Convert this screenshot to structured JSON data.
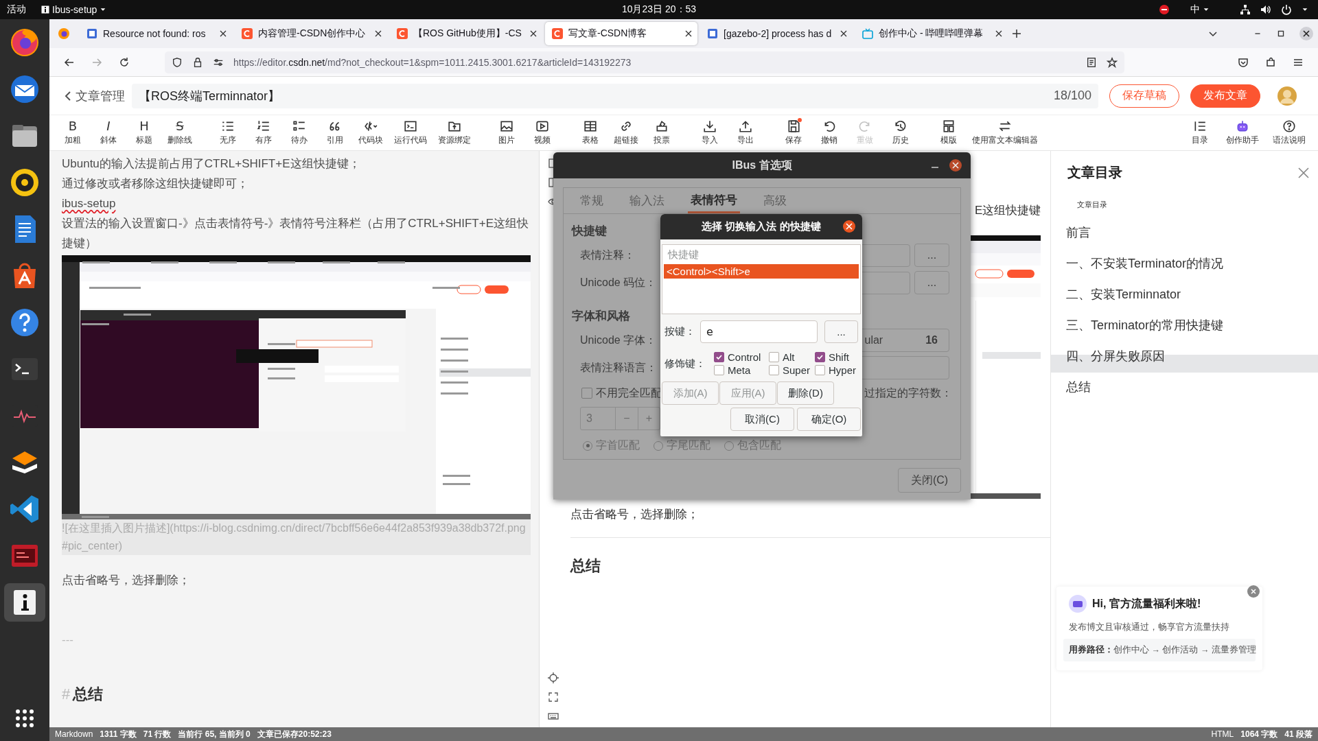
{
  "top_bar": {
    "activities": "活动",
    "app_menu": "Ibus-setup",
    "clock": "10月23日  20：53",
    "input_method": "中"
  },
  "dock": {
    "apps": [
      {
        "kind": "firefox",
        "selected": false
      },
      {
        "kind": "mail",
        "selected": false
      },
      {
        "kind": "files",
        "selected": false
      },
      {
        "kind": "music",
        "selected": false
      },
      {
        "kind": "writer",
        "selected": false
      },
      {
        "kind": "store",
        "selected": false
      },
      {
        "kind": "help",
        "selected": false
      },
      {
        "kind": "terminal",
        "selected": false
      },
      {
        "kind": "monitor",
        "selected": false
      },
      {
        "kind": "stack",
        "selected": false
      },
      {
        "kind": "vscode",
        "selected": false
      },
      {
        "kind": "redapp",
        "selected": false
      },
      {
        "kind": "info",
        "selected": true
      }
    ]
  },
  "browser": {
    "tabs": [
      {
        "title": "Resource not found: ros",
        "kind": "page",
        "selected": false
      },
      {
        "title": "内容管理-CSDN创作中心",
        "kind": "csdn",
        "selected": false
      },
      {
        "title": "【ROS GitHub使用】-CS",
        "kind": "csdn",
        "selected": false
      },
      {
        "title": "写文章-CSDN博客",
        "kind": "csdn",
        "selected": true
      },
      {
        "title": "[gazebo-2] process has d",
        "kind": "page",
        "selected": false
      },
      {
        "title": "创作中心 - 哔哩哔哩弹幕",
        "kind": "tv",
        "selected": false
      }
    ],
    "url": "https://editor.**csdn.net**/md?not_checkout=1&spm=1011.2415.3001.6217&articleId=143192273"
  },
  "csdn_header": {
    "back_label": "文章管理",
    "title": "【ROS终端Terminnator】",
    "count": "18/100",
    "save_draft": "保存草稿",
    "publish": "发布文章"
  },
  "toolbar": {
    "groups": [
      [
        {
          "label": "加粗",
          "glyph": "B",
          "disabled": false,
          "dot": false
        },
        {
          "label": "斜体",
          "glyph": "I",
          "disabled": false,
          "dot": false
        },
        {
          "label": "标题",
          "glyph": "H",
          "disabled": false,
          "dot": false
        },
        {
          "label": "删除线",
          "glyph": "S",
          "disabled": false,
          "dot": false
        }
      ],
      [
        {
          "label": "无序",
          "disabled": false,
          "dot": false
        },
        {
          "label": "有序",
          "disabled": false,
          "dot": false
        },
        {
          "label": "待办",
          "disabled": false,
          "dot": false
        },
        {
          "label": "引用",
          "disabled": false,
          "dot": false
        },
        {
          "label": "代码块",
          "disabled": false,
          "dot": false
        },
        {
          "label": "运行代码",
          "disabled": false,
          "dot": false
        },
        {
          "label": "资源绑定",
          "disabled": false,
          "dot": false
        }
      ],
      [
        {
          "label": "图片",
          "disabled": false,
          "dot": false
        },
        {
          "label": "视频",
          "disabled": false,
          "dot": false
        }
      ],
      [
        {
          "label": "表格",
          "disabled": false,
          "dot": false
        },
        {
          "label": "超链接",
          "disabled": false,
          "dot": false
        },
        {
          "label": "投票",
          "disabled": false,
          "dot": false
        }
      ],
      [
        {
          "label": "导入",
          "disabled": false,
          "dot": false
        },
        {
          "label": "导出",
          "disabled": false,
          "dot": false
        }
      ],
      [
        {
          "label": "保存",
          "disabled": false,
          "dot": true
        },
        {
          "label": "撤销",
          "disabled": false,
          "dot": false
        },
        {
          "label": "重做",
          "disabled": true,
          "dot": false
        },
        {
          "label": "历史",
          "disabled": false,
          "dot": false
        }
      ],
      [
        {
          "label": "模版",
          "disabled": false,
          "dot": false
        },
        {
          "label": "使用富文本编辑器",
          "disabled": false,
          "dot": false
        }
      ]
    ],
    "right": [
      {
        "label": "目录",
        "disabled": false,
        "dot": false
      },
      {
        "label": "创作助手",
        "disabled": false,
        "dot": false
      },
      {
        "label": "语法说明",
        "disabled": false,
        "dot": false
      }
    ]
  },
  "editor": {
    "blocks": [
      {
        "kind": "text",
        "text": "Ubuntu的输入法提前占用了CTRL+SHIFT+E这组快捷键；"
      },
      {
        "kind": "text",
        "text": "通过修改或者移除这组快捷键即可；"
      },
      {
        "kind": "misspelled",
        "text": "ibus-setup"
      },
      {
        "kind": "text",
        "text": "设置法的输入设置窗口-》点击表情符号-》表情符号注释栏（占用了CTRL+SHIFT+E这组快捷键）"
      },
      {
        "kind": "image"
      },
      {
        "kind": "image_link",
        "text": "![在这里插入图片描述](https://i-blog.csdnimg.cn/direct/7bcbff56e6e44f2a853f939a38db372f.png#pic_center)"
      },
      {
        "kind": "text",
        "text": "点击省略号，选择删除；"
      },
      {
        "kind": "rule",
        "text": "---"
      },
      {
        "kind": "heading",
        "mark": "#",
        "text": "总结"
      }
    ]
  },
  "preview": {
    "fragment": "E这组快捷键",
    "paragraph": "点击省略号，选择删除；",
    "heading": "总结"
  },
  "toc": {
    "title": "文章目录",
    "subtitle": "文章目录",
    "items": [
      {
        "text": "前言",
        "selected": false
      },
      {
        "text": "一、不安装Terminator的情况",
        "selected": false
      },
      {
        "text": "二、安装Terminnator",
        "selected": false
      },
      {
        "text": "三、Terminator的常用快捷键",
        "selected": false
      },
      {
        "text": "四、分屏失败原因",
        "selected": true
      },
      {
        "text": "总结",
        "selected": false
      }
    ]
  },
  "promo": {
    "title": "Hi, 官方流量福利来啦!",
    "text": "发布博文且审核通过，畅享官方流量扶持",
    "path": "**用券路径：**创作中心 → 创作活动 → 流量券管理"
  },
  "status_bar": {
    "left_mode": "Markdown",
    "left_stats": [
      "1311 字数",
      "71 行数",
      "当前行 65, 当前列 0",
      "文章已保存20:52:23"
    ],
    "right_mode": "HTML",
    "right_stats": [
      "1064 字数",
      "41 段落"
    ]
  },
  "ibus_window": {
    "title": "IBus 首选项",
    "tabs": [
      {
        "label": "常规",
        "selected": false
      },
      {
        "label": "输入法",
        "selected": false
      },
      {
        "label": "表情符号",
        "selected": true
      },
      {
        "label": "高级",
        "selected": false
      }
    ],
    "shortcuts_heading": "快捷键",
    "emoji_label": "表情注释：",
    "unicode_label": "Unicode 码位：",
    "more_buttons": [
      "...",
      "..."
    ],
    "font_heading": "字体和风格",
    "font_label": "Unicode 字体：",
    "font_value": "ular",
    "font_size": "16",
    "lang_label": "表情注释语言：",
    "partial_check": {
      "text": "不用完全匹配",
      "checked": false
    },
    "partial_tail": "过指定的字符数：",
    "spin_value": "3",
    "spin_buttons": [
      "−",
      "+"
    ],
    "radios": [
      {
        "label": "字首匹配",
        "selected": true
      },
      {
        "label": "字尾匹配",
        "selected": false
      },
      {
        "label": "包含匹配",
        "selected": false
      }
    ],
    "close_button": "关闭(C)"
  },
  "key_dialog": {
    "title": "选择 切换输入法 的快捷键",
    "list_header": "快捷键",
    "shortcuts": [
      {
        "text": "<Control><Shift>e",
        "selected": true
      }
    ],
    "key_label": "按键：",
    "key_value": "e",
    "more_button": "...",
    "modifier_label": "修饰键：",
    "modifiers": [
      {
        "label": "Control",
        "checked": true
      },
      {
        "label": "Alt",
        "checked": false
      },
      {
        "label": "Shift",
        "checked": true
      },
      {
        "label": "Meta",
        "checked": false
      },
      {
        "label": "Super",
        "checked": false
      },
      {
        "label": "Hyper",
        "checked": false
      }
    ],
    "buttons": [
      {
        "label": "添加(A)",
        "disabled": true
      },
      {
        "label": "应用(A)",
        "disabled": true
      },
      {
        "label": "删除(D)",
        "disabled": false
      }
    ],
    "cancel": "取消(C)",
    "ok": "确定(O)"
  }
}
